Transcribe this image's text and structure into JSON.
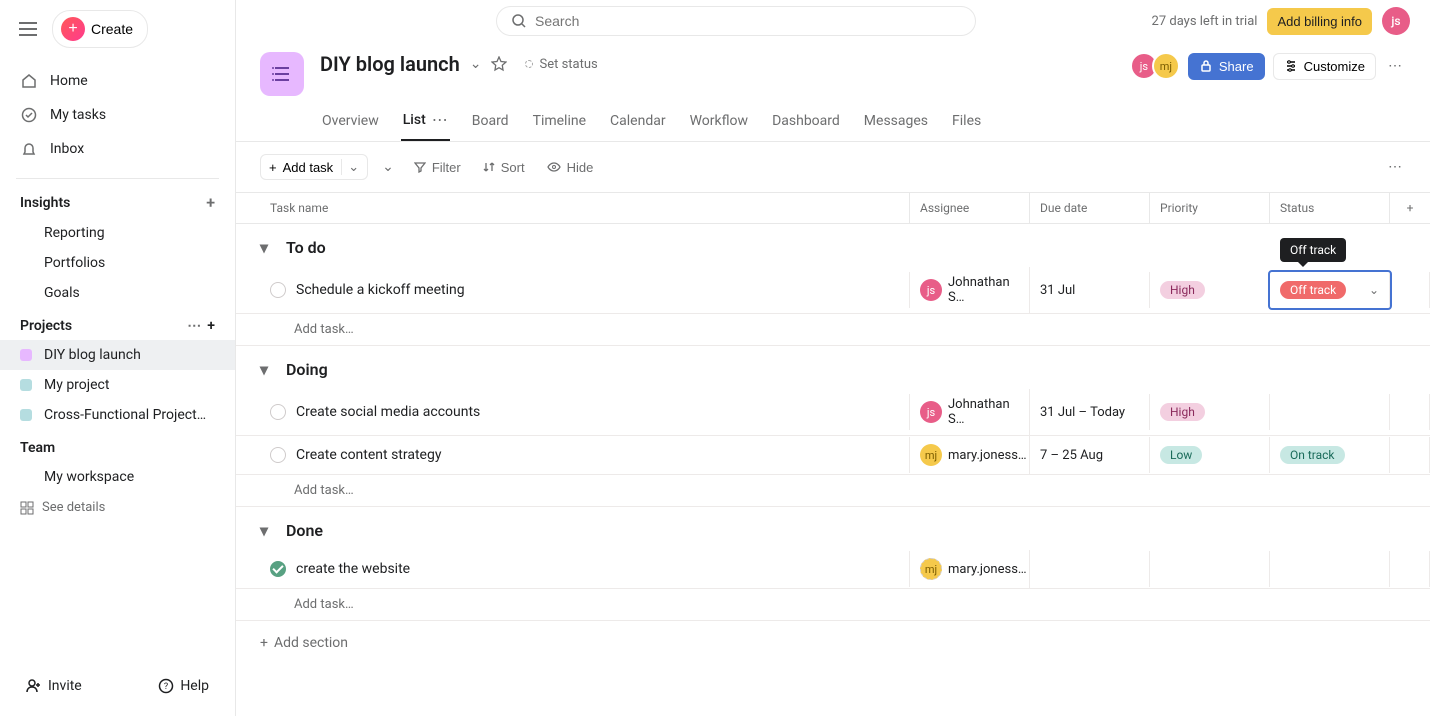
{
  "trial": {
    "days_left_text": "27 days left in trial",
    "billing_button": "Add billing info"
  },
  "search": {
    "placeholder": "Search"
  },
  "sidebar": {
    "create_label": "Create",
    "nav": [
      {
        "label": "Home",
        "icon": "home"
      },
      {
        "label": "My tasks",
        "icon": "check"
      },
      {
        "label": "Inbox",
        "icon": "bell"
      }
    ],
    "insights": {
      "header": "Insights",
      "items": [
        {
          "label": "Reporting"
        },
        {
          "label": "Portfolios"
        },
        {
          "label": "Goals"
        }
      ]
    },
    "projects": {
      "header": "Projects",
      "items": [
        {
          "label": "DIY blog launch",
          "color": "#e7b8ff",
          "active": true
        },
        {
          "label": "My project",
          "color": "#b5dde0"
        },
        {
          "label": "Cross-Functional Project…",
          "color": "#b5dde0"
        }
      ]
    },
    "team": {
      "header": "Team",
      "workspace_label": "My workspace",
      "see_details": "See details"
    },
    "invite_label": "Invite",
    "help_label": "Help"
  },
  "project": {
    "title": "DIY blog launch",
    "set_status": "Set status",
    "share_label": "Share",
    "customize_label": "Customize",
    "avatars": [
      "js",
      "mj"
    ],
    "tabs": [
      {
        "label": "Overview"
      },
      {
        "label": "List",
        "active": true
      },
      {
        "label": "Board"
      },
      {
        "label": "Timeline"
      },
      {
        "label": "Calendar"
      },
      {
        "label": "Workflow"
      },
      {
        "label": "Dashboard"
      },
      {
        "label": "Messages"
      },
      {
        "label": "Files"
      }
    ]
  },
  "toolbar": {
    "add_task": "Add task",
    "filter": "Filter",
    "sort": "Sort",
    "hide": "Hide"
  },
  "columns": {
    "task_name": "Task name",
    "assignee": "Assignee",
    "due_date": "Due date",
    "priority": "Priority",
    "status": "Status"
  },
  "sections": [
    {
      "name": "To do",
      "tasks": [
        {
          "name": "Schedule a kickoff meeting",
          "assignee": {
            "initials": "js",
            "name": "Johnathan S…"
          },
          "due": "31 Jul",
          "priority": "High",
          "status": "Off track",
          "status_focused": true,
          "tooltip": "Off track"
        }
      ]
    },
    {
      "name": "Doing",
      "tasks": [
        {
          "name": "Create social media accounts",
          "assignee": {
            "initials": "js",
            "name": "Johnathan S…"
          },
          "due": "31 Jul – Today",
          "priority": "High",
          "status": ""
        },
        {
          "name": "Create content strategy",
          "assignee": {
            "initials": "mj",
            "name": "mary.joness…"
          },
          "due": "7 – 25 Aug",
          "priority": "Low",
          "status": "On track"
        }
      ]
    },
    {
      "name": "Done",
      "tasks": [
        {
          "name": "create the website",
          "assignee": {
            "initials": "mj",
            "name": "mary.joness…",
            "dashed": true
          },
          "due": "",
          "priority": "",
          "status": "",
          "completed": true
        }
      ]
    }
  ],
  "add_task_link": "Add task…",
  "add_section_label": "Add section"
}
